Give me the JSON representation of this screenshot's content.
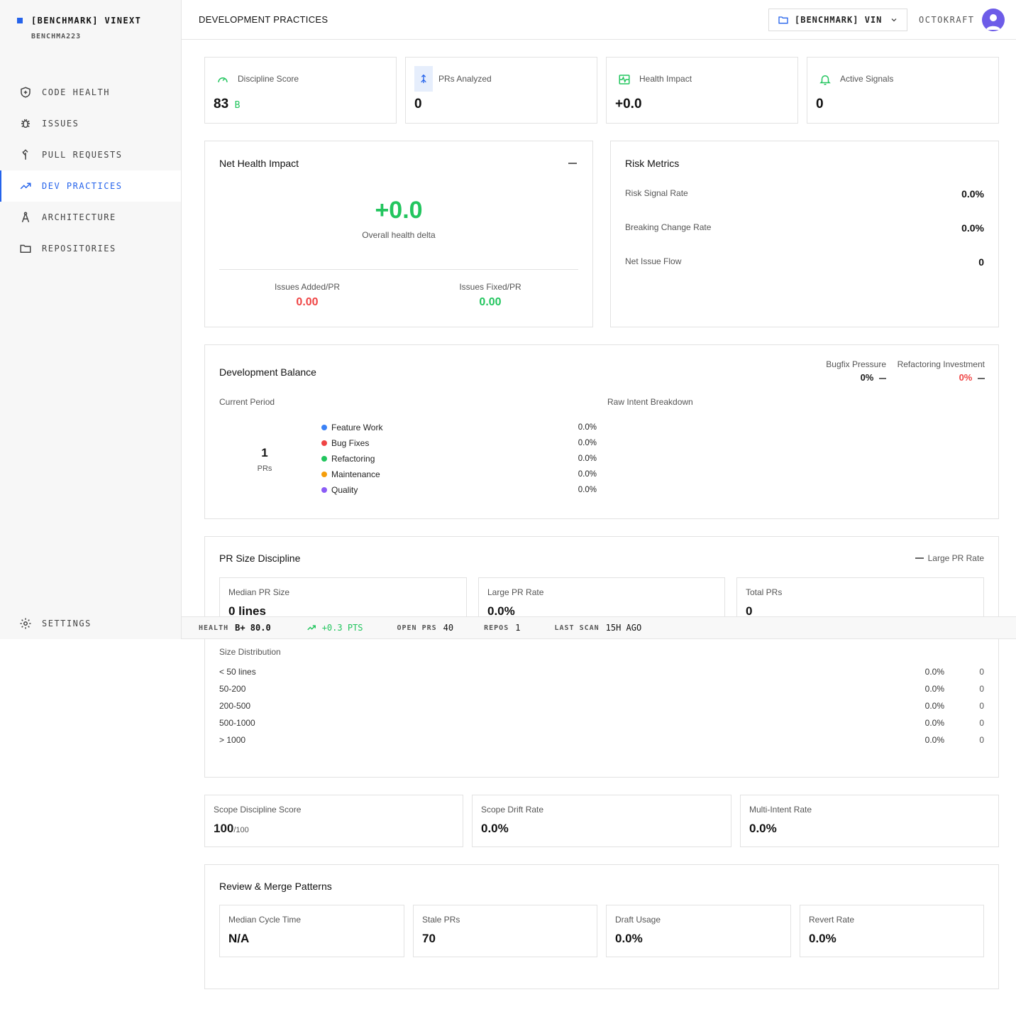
{
  "brand": {
    "name": "[BENCHMARK] VINEXT",
    "sub": "BENCHMA223"
  },
  "nav": [
    {
      "label": "CODE HEALTH",
      "icon": "shield-icon"
    },
    {
      "label": "ISSUES",
      "icon": "bug-icon"
    },
    {
      "label": "PULL REQUESTS",
      "icon": "merge-icon"
    },
    {
      "label": "DEV PRACTICES",
      "icon": "trending-up-icon",
      "active": true
    },
    {
      "label": "ARCHITECTURE",
      "icon": "compass-icon"
    },
    {
      "label": "REPOSITORIES",
      "icon": "folder-icon"
    }
  ],
  "settings_label": "SETTINGS",
  "header": {
    "title": "DEVELOPMENT PRACTICES",
    "repo": "[BENCHMARK] VIN...",
    "user": "OCTOKRAFT"
  },
  "stats": [
    {
      "label": "Discipline Score",
      "value": "83",
      "grade": "B"
    },
    {
      "label": "PRs Analyzed",
      "value": "0"
    },
    {
      "label": "Health Impact",
      "value": "+0.0"
    },
    {
      "label": "Active Signals",
      "value": "0"
    }
  ],
  "net_health": {
    "title": "Net Health Impact",
    "value": "+0.0",
    "caption": "Overall health delta",
    "added_label": "Issues Added/PR",
    "added_value": "0.00",
    "fixed_label": "Issues Fixed/PR",
    "fixed_value": "0.00"
  },
  "risk": {
    "title": "Risk Metrics",
    "rows": [
      {
        "label": "Risk Signal Rate",
        "value": "0.0%"
      },
      {
        "label": "Breaking Change Rate",
        "value": "0.0%"
      },
      {
        "label": "Net Issue Flow",
        "value": "0"
      }
    ]
  },
  "balance": {
    "title": "Development Balance",
    "bugfix_label": "Bugfix Pressure",
    "bugfix_value": "0%",
    "refactor_label": "Refactoring Investment",
    "refactor_value": "0%",
    "current_label": "Current Period",
    "raw_label": "Raw Intent Breakdown",
    "pr_count": "1",
    "pr_unit": "PRs",
    "items": [
      {
        "label": "Feature Work",
        "value": "0.0%",
        "color": "#3b82f6"
      },
      {
        "label": "Bug Fixes",
        "value": "0.0%",
        "color": "#ef4444"
      },
      {
        "label": "Refactoring",
        "value": "0.0%",
        "color": "#22c55e"
      },
      {
        "label": "Maintenance",
        "value": "0.0%",
        "color": "#f59e0b"
      },
      {
        "label": "Quality",
        "value": "0.0%",
        "color": "#8b5cf6"
      }
    ]
  },
  "pr_size": {
    "title": "PR Size Discipline",
    "legend": "Large PR Rate",
    "median_label": "Median PR Size",
    "median_value": "0 lines",
    "large_label": "Large PR Rate",
    "large_value": "0.0%",
    "total_label": "Total PRs",
    "total_value": "0",
    "dist_label": "Size Distribution",
    "dist": [
      {
        "range": "< 50 lines",
        "pct": "0.0%",
        "count": "0"
      },
      {
        "range": "50-200",
        "pct": "0.0%",
        "count": "0"
      },
      {
        "range": "200-500",
        "pct": "0.0%",
        "count": "0"
      },
      {
        "range": "500-1000",
        "pct": "0.0%",
        "count": "0"
      },
      {
        "range": "> 1000",
        "pct": "0.0%",
        "count": "0"
      }
    ]
  },
  "scope": {
    "score_label": "Scope Discipline Score",
    "score_value": "100",
    "score_max": "/100",
    "drift_label": "Scope Drift Rate",
    "drift_value": "0.0%",
    "multi_label": "Multi-Intent Rate",
    "multi_value": "0.0%"
  },
  "review": {
    "title": "Review & Merge Patterns",
    "items": [
      {
        "label": "Median Cycle Time",
        "value": "N/A"
      },
      {
        "label": "Stale PRs",
        "value": "70"
      },
      {
        "label": "Draft Usage",
        "value": "0.0%"
      },
      {
        "label": "Revert Rate",
        "value": "0.0%"
      }
    ]
  },
  "statusbar": {
    "health_label": "HEALTH",
    "health_value": "B+ 80.0",
    "delta": "+0.3 PTS",
    "open_label": "OPEN PRS",
    "open_value": "40",
    "repos_label": "REPOS",
    "repos_value": "1",
    "scan_label": "LAST SCAN",
    "scan_value": "15H AGO"
  }
}
